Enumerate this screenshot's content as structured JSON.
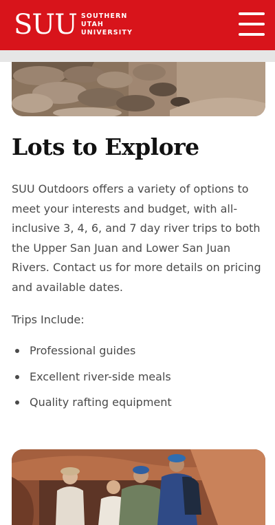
{
  "header": {
    "logo_mark": "SUU",
    "logo_line1": "SOUTHERN",
    "logo_line2": "UTAH",
    "logo_line3": "UNIVERSITY",
    "brand_color": "#d8141b",
    "menu_icon": "hamburger-menu-icon"
  },
  "main": {
    "heading": "Lots to Explore",
    "paragraph": "SUU Outdoors offers a variety of options to meet your interests and budget, with all-inclusive 3, 4, 6, and 7 day river trips to both the Upper San Juan and Lower San Juan Rivers. Contact us for more details on pricing and available dates.",
    "trips_label": "Trips Include:",
    "trips": [
      "Professional guides",
      "Excellent river-side meals",
      "Quality rafting equipment"
    ]
  }
}
